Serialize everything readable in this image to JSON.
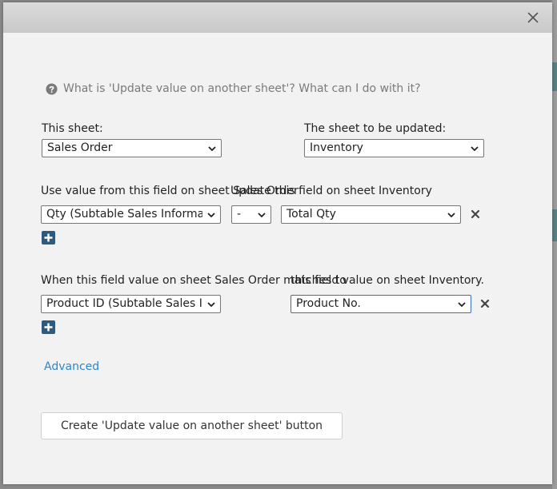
{
  "help": {
    "text": "What is 'Update value on another sheet'? What can I do with it?",
    "icon": "question-circle-icon"
  },
  "this_sheet": {
    "label": "This sheet:",
    "value": "Sales Order"
  },
  "target_sheet": {
    "label": "The sheet to be updated:",
    "value": "Inventory"
  },
  "value_mapping": {
    "label_source": "Use value from this field on sheet Sales Order",
    "label_target": "Update this field on sheet Inventory",
    "source_field": "Qty (Subtable Sales Informa",
    "operator": "-",
    "target_field": "Total Qty"
  },
  "match_mapping": {
    "label_source": "When this field value on sheet Sales Order matches to",
    "label_target": "this field value on sheet Inventory.",
    "source_field": "Product ID (Subtable Sales In",
    "target_field": "Product No."
  },
  "advanced_link": "Advanced",
  "create_button": "Create 'Update value on another sheet' button",
  "colors": {
    "link": "#2f86c9",
    "plus_button": "#2e5a7f",
    "focus_border": "#3b6fb3"
  }
}
